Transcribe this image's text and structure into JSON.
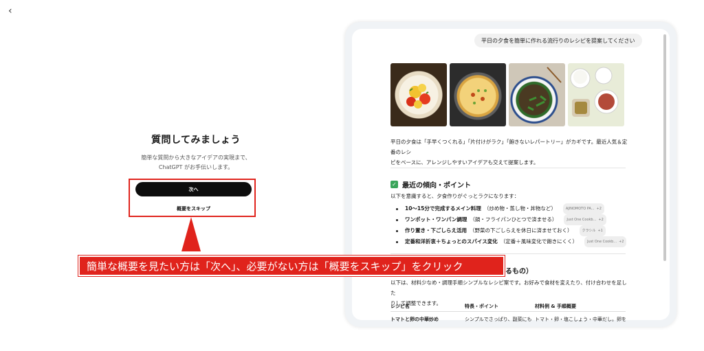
{
  "nav": {
    "back_icon": "‹"
  },
  "intro": {
    "title": "質問してみましょう",
    "subtitle_line1": "簡単な質問から大きなアイデアの実現まで、",
    "subtitle_line2": "ChatGPT がお手伝いします。",
    "next_label": "次へ",
    "skip_label": "概要をスキップ"
  },
  "callout": {
    "text": "簡単な概要を見たい方は「次へ」、必要がない方は「概要をスキップ」をクリック",
    "color": "#e0231c"
  },
  "preview": {
    "prompt": "平日の夕食を簡単に作れる流行りのレシピを提案してください",
    "images": [
      "tomato-egg-dish",
      "cheese-gratin-dish",
      "stir-fry-dish",
      "set-meal-dishes"
    ],
    "intro_line1": "平日の夕食は「手早くつくれる」「片付けがラク」「飽きないレパートリー」がカギです。最近人気＆定番のレシ",
    "intro_line2": "ピをベースに、アレンジしやすいアイデアも交えて提案します。",
    "section1_title": "最近の傾向・ポイント",
    "section1_lead": "以下を意識すると、夕食作りがぐっとラクになります：",
    "bullets": [
      {
        "bold": "10〜15分で完成するメイン料理",
        "rest": "（炒め物・蒸し物・丼物など）",
        "tag": "AJINOMOTO PA...",
        "count": "+2"
      },
      {
        "bold": "ワンポット・ワンパン調理",
        "rest": "（鍋・フライパンひとつで済ませる）",
        "tag": "Just One Cookb...",
        "count": "+2"
      },
      {
        "bold": "作り置き・下ごしらえ活用",
        "rest": "（野菜の下ごしらえを休日に済ませておく）",
        "tag": "クラシル",
        "count": "+1"
      },
      {
        "bold": "定番和洋折衷＋ちょっとのスパイス変化",
        "rest": "（定番＋風味変化で飽きにくく）",
        "tag": "Just One Cookb...",
        "count": "+2"
      }
    ],
    "section2_title_tail": "るもの）",
    "section2_line1": "以下は、材料少なめ・調理手順シンプルなレシピ案です。お好みで食材を変えたり、付け合わせを足した",
    "section2_line2": "りして調整できます。",
    "table": {
      "headers": [
        "レシピ名",
        "特長・ポイント",
        "材料例 & 手順概要"
      ],
      "row1": [
        "トマトと卵の中華炒め",
        "シンプルでさっぱり、副菜にも",
        "トマト・卵・塩こしょう・中華だし。卵をふんわり"
      ]
    }
  }
}
